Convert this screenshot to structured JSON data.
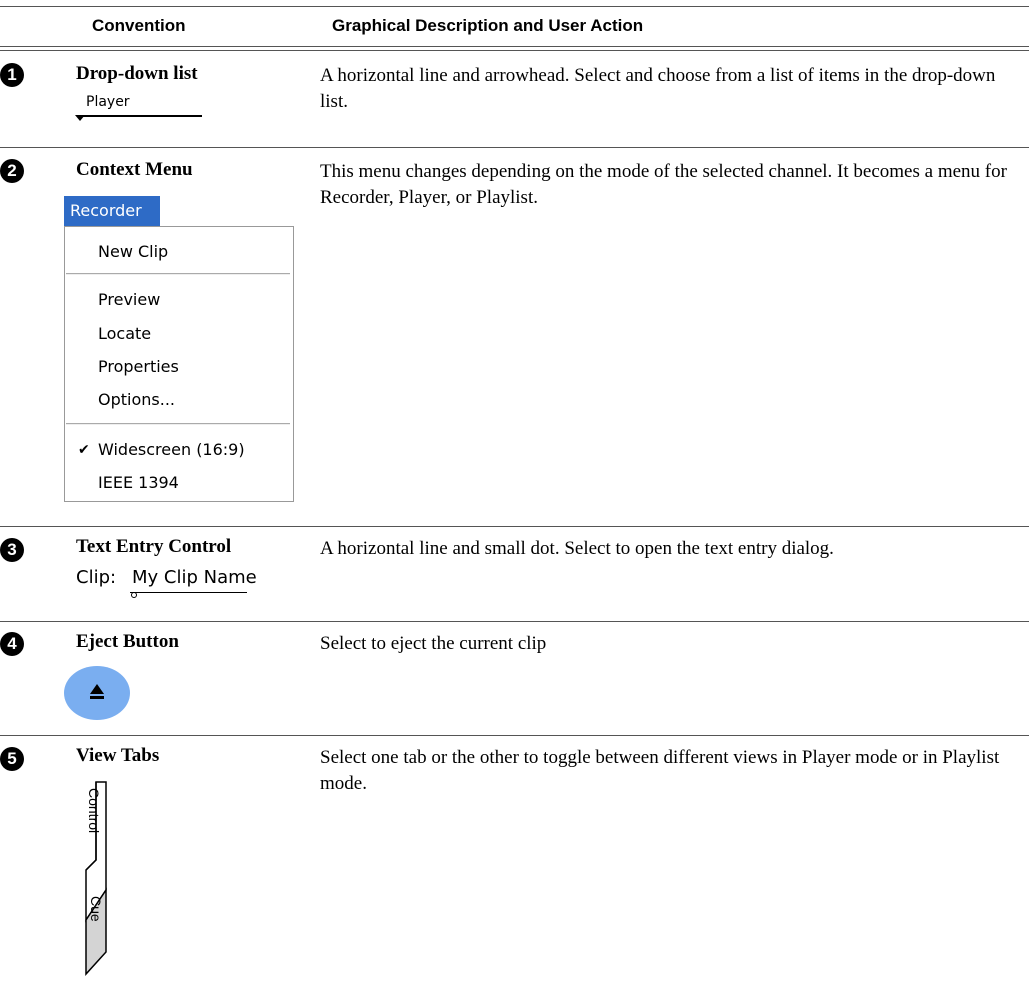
{
  "table": {
    "headers": [
      "Convention",
      "Graphical Description and User Action"
    ],
    "rows": [
      {
        "number": "1",
        "term": "Drop-down list",
        "description": "A horizontal line and arrowhead. Select and choose from a list of items in the drop-down list.",
        "visual": {
          "label": "Player"
        }
      },
      {
        "number": "2",
        "term": "Context Menu",
        "description": "This menu changes depending on the mode of the selected channel. It becomes a menu for Recorder, Player, or Playlist.",
        "visual": {
          "title": "Recorder",
          "items": [
            "New Clip",
            "Preview",
            "Locate",
            "Properties",
            "Options...",
            "Widescreen (16:9)",
            "IEEE 1394"
          ]
        }
      },
      {
        "number": "3",
        "term": "Text Entry Control",
        "description": "A horizontal line and small dot. Select to open the text entry dialog.",
        "visual": {
          "label": "Clip:",
          "value": "My Clip Name"
        }
      },
      {
        "number": "4",
        "term": "Eject Button",
        "description": "Select to eject the current clip",
        "visual": {
          "icon": "eject-icon",
          "color": "#7aaef0"
        }
      },
      {
        "number": "5",
        "term": "View Tabs",
        "description": "Select one tab or the other to toggle between different views in Player mode or in Playlist mode.",
        "visual": {
          "tabs": [
            "Control",
            "Cue"
          ]
        }
      }
    ]
  },
  "colors": {
    "menu_title_bg": "#2e6bc6",
    "eject_bg": "#7aaef0"
  }
}
